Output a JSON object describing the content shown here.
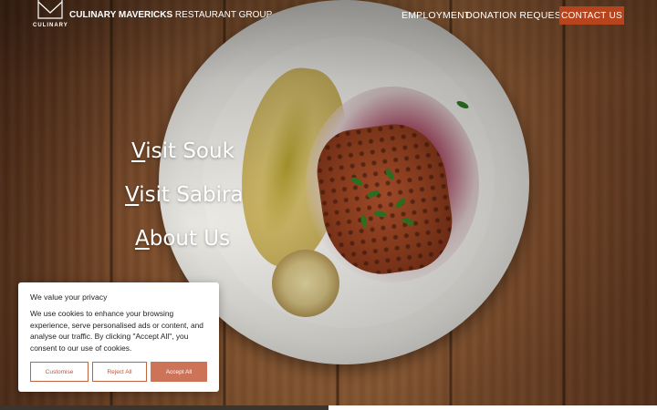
{
  "header": {
    "logo_sub": "CULINARY",
    "brand_bold": "CULINARY MAVERICKS",
    "brand_rest": " RESTAURANT GROUP",
    "nav": {
      "employment": "EMPLOYMENT",
      "donation": "DONATION REQUESTS",
      "contact": "CONTACT US"
    }
  },
  "hero": {
    "links": [
      {
        "first": "V",
        "rest": "isit Souk"
      },
      {
        "first": "V",
        "rest": "isit Sabira"
      },
      {
        "first": "A",
        "rest": "bout Us"
      }
    ]
  },
  "cookie": {
    "title": "We value your privacy",
    "body": "We use cookies to enhance your browsing experience, serve personalised ads or content, and analyse our traffic. By clicking \"Accept All\", you consent to our use of cookies.",
    "customise": "Customise",
    "reject": "Reject All",
    "accept": "Accept All"
  },
  "colors": {
    "contact_button": "#b8441d",
    "accept_button": "#cc7358",
    "outline_button_text": "#b9573a"
  }
}
